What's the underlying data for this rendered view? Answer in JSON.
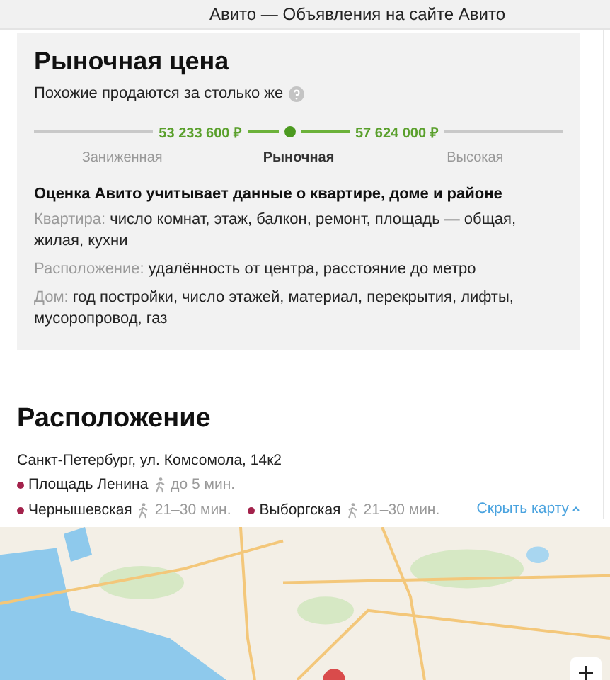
{
  "window": {
    "title": "Авито — Объявления на сайте Авито"
  },
  "market_price": {
    "title": "Рыночная цена",
    "subtitle": "Похожие продаются за столько же",
    "range": {
      "low": "53 233 600 ₽",
      "high": "57 624 000 ₽"
    },
    "segments": [
      {
        "label": "Заниженная",
        "selected": false
      },
      {
        "label": "Рыночная",
        "selected": true
      },
      {
        "label": "Высокая",
        "selected": false
      }
    ],
    "info_title": "Оценка Авито учитывает данные о квартире, доме и районе",
    "factors": [
      {
        "label": "Квартира:",
        "text": "число комнат, этаж, балкон, ремонт, площадь — общая, жилая, кухни"
      },
      {
        "label": "Расположение:",
        "text": "удалённость от центра, расстояние до метро"
      },
      {
        "label": "Дом:",
        "text": "год постройки, число этажей, материал, перекрытия, лифты, мусоропровод, газ"
      }
    ]
  },
  "location": {
    "title": "Расположение",
    "address": "Санкт-Петербург, ул. Комсомола, 14к2",
    "metro": [
      {
        "name": "Площадь Ленина",
        "time": "до 5 мин.",
        "color": "#a3224b"
      },
      {
        "name": "Чернышевская",
        "time": "21–30 мин.",
        "color": "#a3224b"
      },
      {
        "name": "Выборгская",
        "time": "21–30 мин.",
        "color": "#a3224b"
      }
    ],
    "hide_map": "Скрыть карту"
  }
}
